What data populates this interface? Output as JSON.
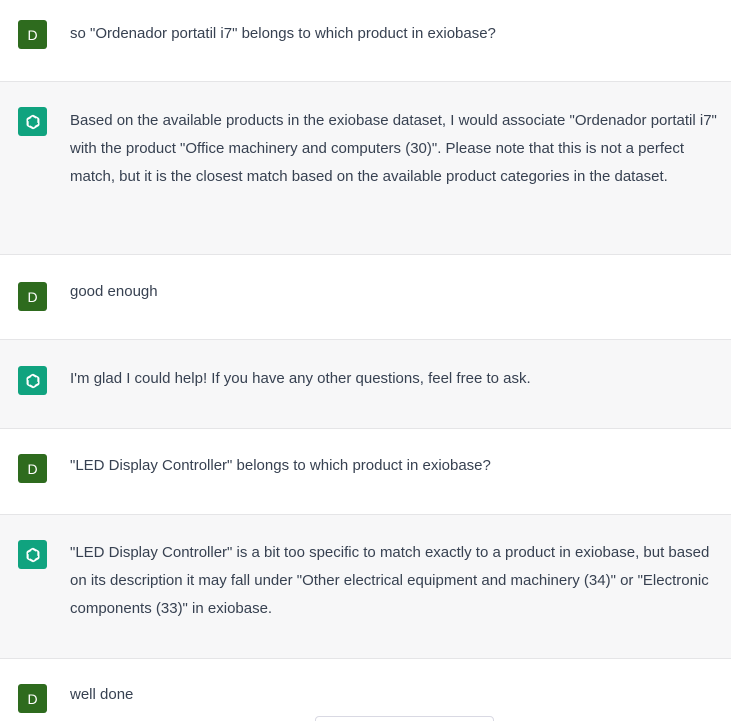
{
  "conversation": {
    "messages": [
      {
        "role": "user",
        "avatar_letter": "D",
        "text": "so \"Ordenador portatil i7\" belongs to which product in exiobase?"
      },
      {
        "role": "assistant",
        "avatar_icon": "openai-logo-icon",
        "text": "Based on the available products in the exiobase dataset, I would associate \"Ordenador portatil i7\" with the product \"Office machinery and computers (30)\". Please note that this is not a perfect match, but it is the closest match based on the available product categories in the dataset."
      },
      {
        "role": "user",
        "avatar_letter": "D",
        "text": "good enough"
      },
      {
        "role": "assistant",
        "avatar_icon": "openai-logo-icon",
        "text": "I'm glad I could help! If you have any other questions, feel free to ask."
      },
      {
        "role": "user",
        "avatar_letter": "D",
        "text": "\"LED Display Controller\" belongs to which product in exiobase?"
      },
      {
        "role": "assistant",
        "avatar_icon": "openai-logo-icon",
        "text": "\"LED Display Controller\" is a bit too specific to match exactly to a product in exiobase, but based on its description it may fall under \"Other electrical equipment and machinery (34)\" or \"Electronic components (33)\" in exiobase."
      },
      {
        "role": "user",
        "avatar_letter": "D",
        "text": "well done"
      }
    ]
  },
  "colors": {
    "user_avatar": "#2e6b1e",
    "assistant_avatar": "#10a37f",
    "assistant_bg": "#f7f7f8",
    "text": "#374151"
  }
}
